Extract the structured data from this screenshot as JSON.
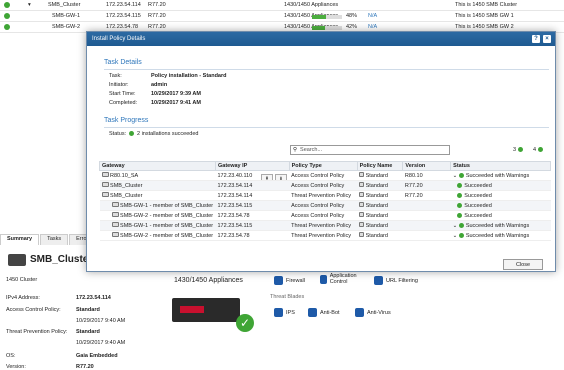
{
  "bg_rows": [
    {
      "name": "SMB_Cluster",
      "ip": "172.23.54.114",
      "ver": "R77.20",
      "hw": "1430/1450 Appliances",
      "pct": "",
      "bar": null,
      "link": "",
      "comment": "This is 1450 SMB Cluster"
    },
    {
      "name": "SMB-GW-1",
      "ip": "172.23.54.115",
      "ver": "R77.20",
      "hw": "1430/1450 Appliances",
      "pct": "48%",
      "bar": 0.48,
      "link": "N/A",
      "comment": "This is 1450 SMB GW 1"
    },
    {
      "name": "SMB-GW-2",
      "ip": "172.23.54.78",
      "ver": "R77.20",
      "hw": "1430/1450 Appliances",
      "pct": "42%",
      "bar": 0.42,
      "link": "N/A",
      "comment": "This is 1450 SMB GW 2"
    }
  ],
  "tabs": [
    "Summary",
    "Tasks",
    "Errors"
  ],
  "summary": {
    "title": "SMB_Cluster",
    "subtitle": "1450 Cluster",
    "hw": "1430/1450 Appliances",
    "fields": [
      {
        "k": "IPv4 Address:",
        "v": "172.23.54.114"
      },
      {
        "k": "Access Control Policy:",
        "v": "Standard"
      },
      {
        "k": "",
        "v": "10/29/2017 9:40 AM"
      },
      {
        "k": "Threat Prevention Policy:",
        "v": "Standard"
      },
      {
        "k": "",
        "v": "10/29/2017 9:40 AM"
      },
      {
        "k": "OS:",
        "v": "Gaia Embedded"
      },
      {
        "k": "Version:",
        "v": "R77.20"
      }
    ],
    "blades_top": [
      "Firewall",
      "Application Control",
      "URL Filtering"
    ],
    "threat_title": "Threat Blades",
    "blades_threat": [
      "IPS",
      "Anti-Bot",
      "Anti-Virus"
    ]
  },
  "modal": {
    "title": "Install Policy Details",
    "task_details": "Task Details",
    "details": [
      {
        "k": "Task:",
        "v": "Policy installation - Standard"
      },
      {
        "k": "Initiator:",
        "v": "admin"
      },
      {
        "k": "Start Time:",
        "v": "10/29/2017 9:39 AM"
      },
      {
        "k": "Completed:",
        "v": "10/29/2017 9:41 AM"
      }
    ],
    "task_progress": "Task Progress",
    "status_label": "Status:",
    "status_value": "2 installations succeeded",
    "search_placeholder": "Search...",
    "count_a": "3",
    "count_b": "4",
    "columns": [
      "Gateway",
      "Gateway IP",
      "Policy Type",
      "Policy Name",
      "Version",
      "Status"
    ],
    "rows": [
      {
        "gw": "R80.10_SA",
        "ip": "172.23.40.110",
        "type": "Access Control Policy",
        "policy": "Standard",
        "ver": "R80.10",
        "status": "Succeeded with Warnings",
        "expand": true
      },
      {
        "gw": "SMB_Cluster",
        "ip": "172.23.54.114",
        "type": "Access Control Policy",
        "policy": "Standard",
        "ver": "R77.20",
        "status": "Succeeded",
        "expand": false
      },
      {
        "gw": "SMB_Cluster",
        "ip": "172.23.54.114",
        "type": "Threat Prevention Policy",
        "policy": "Standard",
        "ver": "R77.20",
        "status": "Succeeded",
        "expand": false
      },
      {
        "gw": "SMB-GW-1 - member of SMB_Cluster",
        "ip": "172.23.54.115",
        "type": "Access Control Policy",
        "policy": "Standard",
        "ver": "",
        "status": "Succeeded",
        "expand": false
      },
      {
        "gw": "SMB-GW-2 - member of SMB_Cluster",
        "ip": "172.23.54.78",
        "type": "Access Control Policy",
        "policy": "Standard",
        "ver": "",
        "status": "Succeeded",
        "expand": false
      },
      {
        "gw": "SMB-GW-1 - member of SMB_Cluster",
        "ip": "172.23.54.115",
        "type": "Threat Prevention Policy",
        "policy": "Standard",
        "ver": "",
        "status": "Succeeded with Warnings",
        "expand": true
      },
      {
        "gw": "SMB-GW-2 - member of SMB_Cluster",
        "ip": "172.23.54.78",
        "type": "Threat Prevention Policy",
        "policy": "Standard",
        "ver": "",
        "status": "Succeeded with Warnings",
        "expand": true
      }
    ],
    "close": "Close"
  }
}
